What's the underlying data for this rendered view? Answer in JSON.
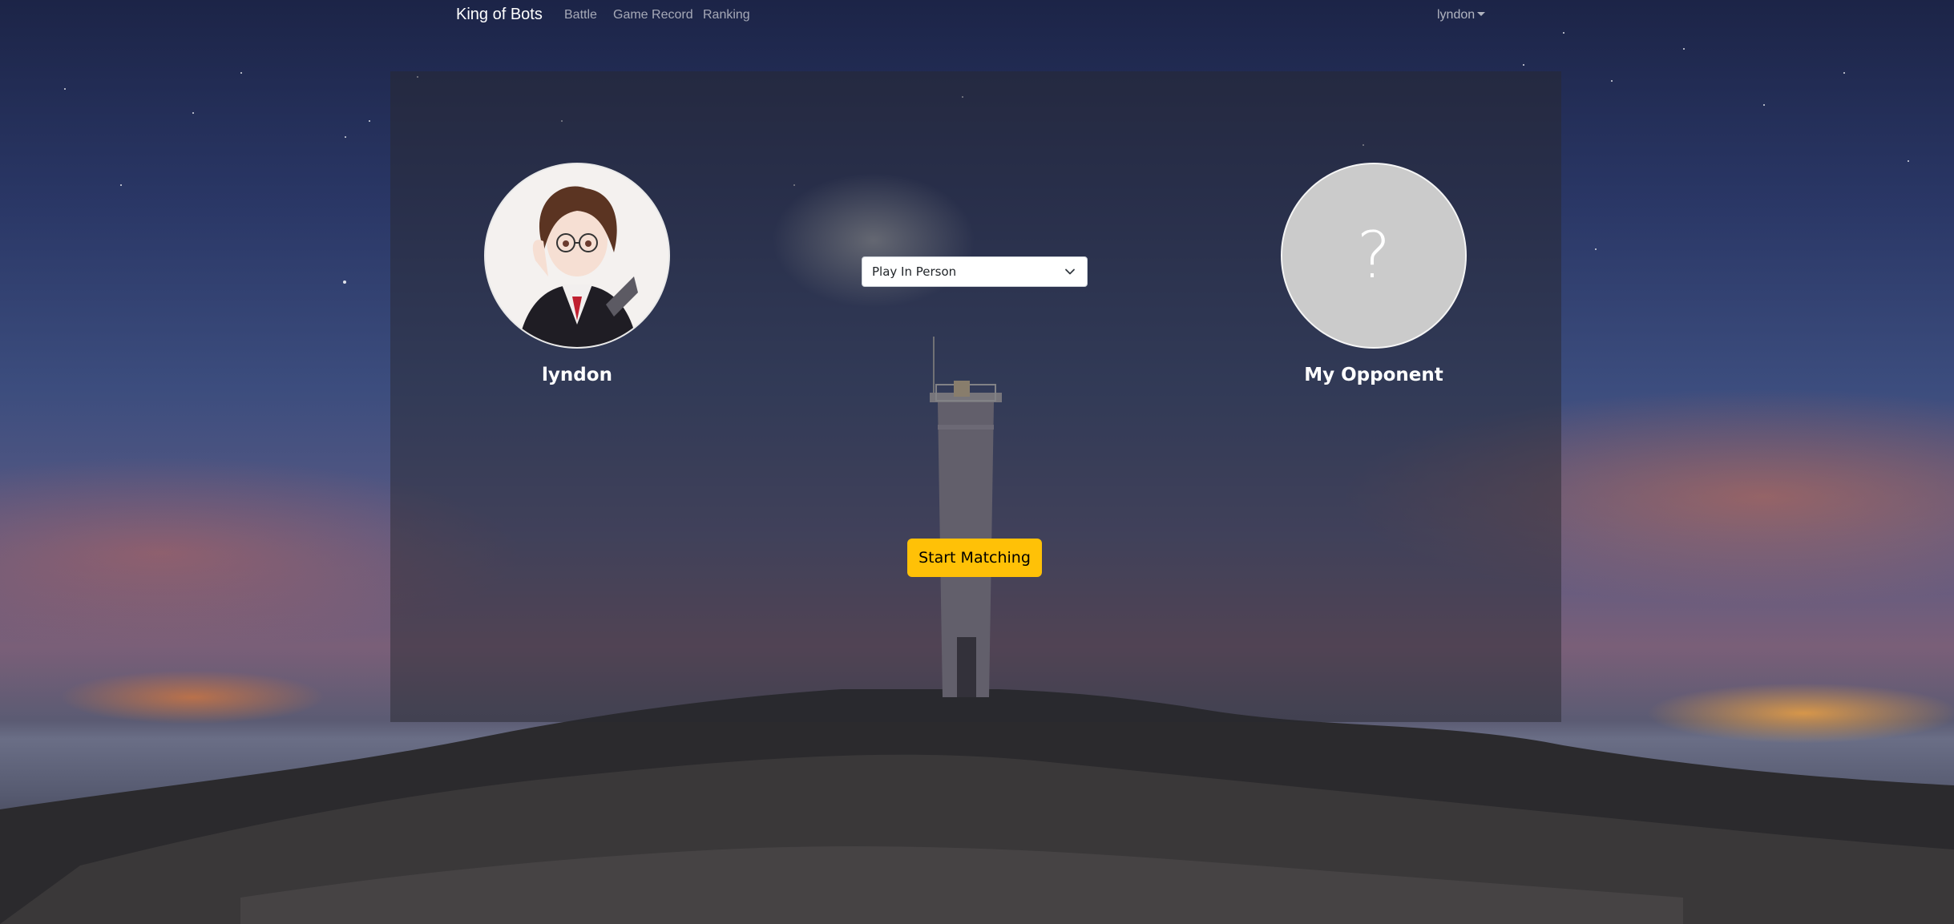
{
  "navbar": {
    "brand": "King of Bots",
    "links": [
      "Battle",
      "Game Record",
      "Ranking"
    ],
    "user": "lyndon"
  },
  "match": {
    "player": {
      "name": "lyndon",
      "avatar": "anime-boy-avatar"
    },
    "opponent": {
      "name": "My Opponent",
      "placeholder": "?"
    },
    "mode_select": {
      "selected": "Play In Person"
    },
    "start_button": "Start Matching"
  },
  "colors": {
    "start_button": "#ffc107",
    "opponent_avatar_bg": "#cbcbcb",
    "card_overlay": "rgba(40,40,48,0.5)"
  }
}
